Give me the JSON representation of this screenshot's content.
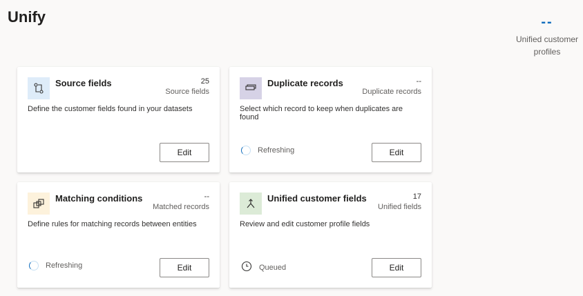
{
  "page": {
    "title": "Unify"
  },
  "summary": {
    "value": "--",
    "label": "Unified customer profiles"
  },
  "colors": {
    "accent": "#0f6cbd"
  },
  "cards": [
    {
      "title": "Source fields",
      "count": "25",
      "count_label": "Source fields",
      "description": "Define the customer fields found in your datasets",
      "status": "",
      "status_icon": "",
      "edit_label": "Edit",
      "icon": "source-fields-icon",
      "icon_bg": "#deecf9"
    },
    {
      "title": "Duplicate records",
      "count": "--",
      "count_label": "Duplicate records",
      "description": "Select which record to keep when duplicates are found",
      "status": "Refreshing",
      "status_icon": "spinner-icon",
      "edit_label": "Edit",
      "icon": "duplicate-records-icon",
      "icon_bg": "#d6d2e6"
    },
    {
      "title": "Matching conditions",
      "count": "--",
      "count_label": "Matched records",
      "description": "Define rules for matching records between entities",
      "status": "Refreshing",
      "status_icon": "spinner-icon",
      "edit_label": "Edit",
      "icon": "matching-conditions-icon",
      "icon_bg": "#fdf2dc"
    },
    {
      "title": "Unified customer fields",
      "count": "17",
      "count_label": "Unified fields",
      "description": "Review and edit customer profile fields",
      "status": "Queued",
      "status_icon": "clock-icon",
      "edit_label": "Edit",
      "icon": "merge-icon",
      "icon_bg": "#dcebd7"
    }
  ]
}
